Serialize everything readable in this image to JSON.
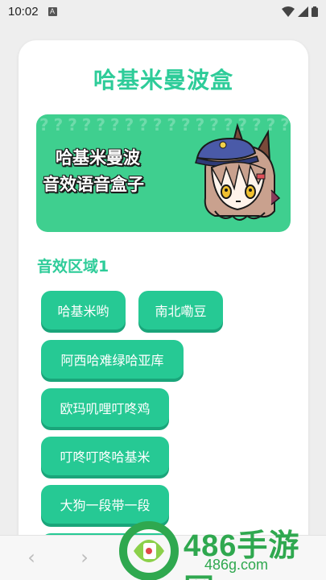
{
  "status_bar": {
    "time": "10:02",
    "notification_icon_letter": "A",
    "icons": [
      "wifi-icon",
      "signal-icon",
      "battery-icon"
    ]
  },
  "app": {
    "title": "哈基米曼波盒"
  },
  "banner": {
    "line1": "哈基米曼波",
    "line2": "音效语音盒子",
    "pattern_char": "?"
  },
  "section": {
    "title": "音效区域1",
    "buttons": [
      {
        "label": "哈基米哟"
      },
      {
        "label": "南北嘞豆"
      },
      {
        "label": "阿西哈难绿哈亚库"
      },
      {
        "label": "欧玛叽哩叮咚鸡"
      },
      {
        "label": "叮咚叮咚哈基米"
      },
      {
        "label": "大狗一段带一段"
      }
    ]
  },
  "nav": {
    "back_glyph": "‹",
    "forward_glyph": "›"
  },
  "watermark": {
    "brand": "486手游网",
    "domain": "486g.com"
  },
  "colors": {
    "accent": "#2ecc99",
    "button": "#26c994",
    "watermark": "#2fa84f"
  }
}
